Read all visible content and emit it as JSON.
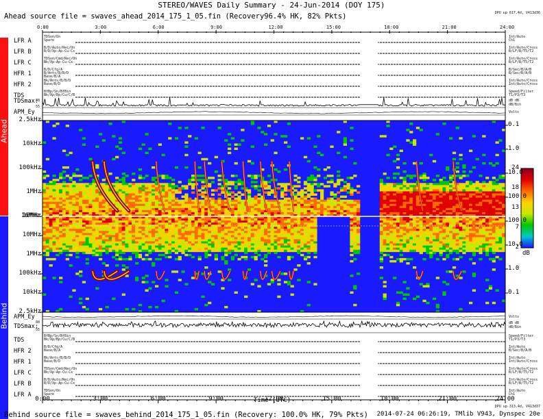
{
  "title": "STEREO/WAVES Daily Summary - 24-Jun-2014 (DOY 175)",
  "ahead_source": "Ahead source file = swaves_ahead_2014_175_1_05.fin (Recovery96.4% HK, 82% Pkts)",
  "behind_source": "Behind source file = swaves_behind_2014_175_1_05.fin (Recovery: 100.0% HK, 79% Pkts)",
  "footer_right": "2014-07-24 06:26:19, TMlib V943, Dynspec 20e",
  "dpu_ahead": "DPU up 617.4d, V413d36",
  "dpu_behind": "DPU up 313.4d, V413d37",
  "band_labels": {
    "ahead": "Ahead",
    "behind": "Behind"
  },
  "band_colors": {
    "ahead": "#ff1010",
    "behind": "#1a1aff"
  },
  "ahead_rows": [
    {
      "label": "LFR A",
      "small_left": [
        "TDSon/On",
        "Spare"
      ],
      "small_right": [
        "Int/Auto",
        "Ch1"
      ]
    },
    {
      "label": "LFR B",
      "small_left": [
        "B/D/Auto/Rec/On",
        "B/D/Xp-Ap-Cu-Cx"
      ],
      "small_right": [
        "Int/Auto/Cross",
        "B/LF/B/T5/T2"
      ]
    },
    {
      "label": "LFR C",
      "small_left": [
        "TDSon/Cmd/Rec/On",
        "Bk/Xp-Ap-Cu-Cx"
      ],
      "small_right": [
        "Int/Auto/Cross",
        "B/LF/B/T5/T2"
      ]
    },
    {
      "label": "HFR 1",
      "small_left": [
        "B/D/Cfg/A",
        "B/Ants/B/B/D",
        "Base/B/A"
      ],
      "small_right": [
        "B/Sec/B/A/B",
        "B/Sec/B/A/B"
      ]
    },
    {
      "label": "HFR 2",
      "small_left": [
        "Bk/Ants/B/B/D",
        "Base/B/D"
      ],
      "small_right": [
        "Int/Auto/Cross",
        "Int/Auto/Cross"
      ]
    },
    {
      "label": "TDS",
      "small_left": [
        "BfBp/Sn/BfBin",
        "Bk/Xp/Bp/Cu/C/B"
      ],
      "small_right": [
        "Speed/Filter",
        "T1/P3/T3"
      ]
    }
  ],
  "behind_rows": [
    {
      "label": "TDS",
      "small_left": [
        "BfBp/Sn/BfBin",
        "Bk/Xp/Bp/Cu/C/B"
      ],
      "small_right": [
        "Speed/Filter",
        "T1/P3/T3"
      ]
    },
    {
      "label": "HFR 2",
      "small_left": [
        "B/D/Cfg/A",
        "Base/B/A"
      ],
      "small_right": [
        "Int/Auto",
        "B/Sec/B/A/B"
      ]
    },
    {
      "label": "HFR 1",
      "small_left": [
        "Bk/Ants/B/B/D",
        "Base/B/D"
      ],
      "small_right": [
        "Int/Auto",
        "Int/Auto/Cross"
      ]
    },
    {
      "label": "LFR C",
      "small_left": [
        "TDSon/Cmd/Rec/On",
        "Bk/Xp-Ap-Cu-Cx"
      ],
      "small_right": [
        "Int/Auto/Cross",
        "B/LF/B/T5/T2"
      ]
    },
    {
      "label": "LFR B",
      "small_left": [
        "B/D/Auto/Rec/On",
        "B/D/Xp-Ap-Cu-Cx"
      ],
      "small_right": [
        "Int/Auto/Cross",
        "B/LF/B/T5/T2"
      ]
    },
    {
      "label": "LFR A",
      "small_left": [
        "TDSon/On",
        "Spare"
      ],
      "small_right": [
        "Int/Auto",
        "Ch1"
      ]
    }
  ],
  "ahead_tds": {
    "label": "TDSmax:",
    "tick_top": "88",
    "tick_bot": "55",
    "right": [
      "dB dB",
      "dB/Bin"
    ]
  },
  "ahead_apm": {
    "label": "APM_Ey",
    "right": "Volts"
  },
  "behind_tds": {
    "label": "TDSmax:",
    "tick_top": "88",
    "tick_bot": "55",
    "right": [
      "dB dB",
      "dB/Bin"
    ]
  },
  "behind_apm": {
    "label": "APM_Ey",
    "right": "Volts"
  },
  "chart_data": {
    "type": "heatmap",
    "xlabel": "Time (UTC)",
    "xticks": [
      "0:00",
      "3:00",
      "6:00",
      "9:00",
      "12:00",
      "15:00",
      "18:00",
      "21:00",
      "24:00"
    ],
    "xlim": [
      0,
      24
    ],
    "ahead_y_ticks": [
      "2.5kHz",
      "10kHz",
      "100kHz",
      "1MHz",
      "10MHz"
    ],
    "behind_y_ticks": [
      "16MHz",
      "10MHz",
      "1MHz",
      "100kHz",
      "10kHz",
      "2.5kHz"
    ],
    "ahead_y2_ticks": [
      "0.1",
      "1.0",
      "10.0",
      "100.0"
    ],
    "behind_y2_ticks": [
      "100.0",
      "10.0",
      "1.0",
      "0.1"
    ],
    "colorbar_ticks": [
      "24",
      "18",
      "13",
      "7",
      "2"
    ],
    "colorbar_unit": "dB",
    "colorscale": [
      "#1a1aff",
      "#00c8c8",
      "#00c800",
      "#c8e800",
      "#ffd000",
      "#ff6a00",
      "#e00000",
      "#8a0020"
    ],
    "colormap_range": [
      2,
      24
    ],
    "type_iii_bursts_hours": [
      2.6,
      3.2,
      5.9,
      7.9,
      8.4,
      9.3,
      10.4,
      11.3,
      11.9,
      12.8,
      19.4,
      21.3
    ],
    "ahead_data_gaps_hours": [
      [
        16.5,
        17.4
      ]
    ],
    "behind_data_gaps_hours": [
      [
        14.2,
        16.0
      ],
      [
        16.5,
        17.4
      ]
    ]
  }
}
